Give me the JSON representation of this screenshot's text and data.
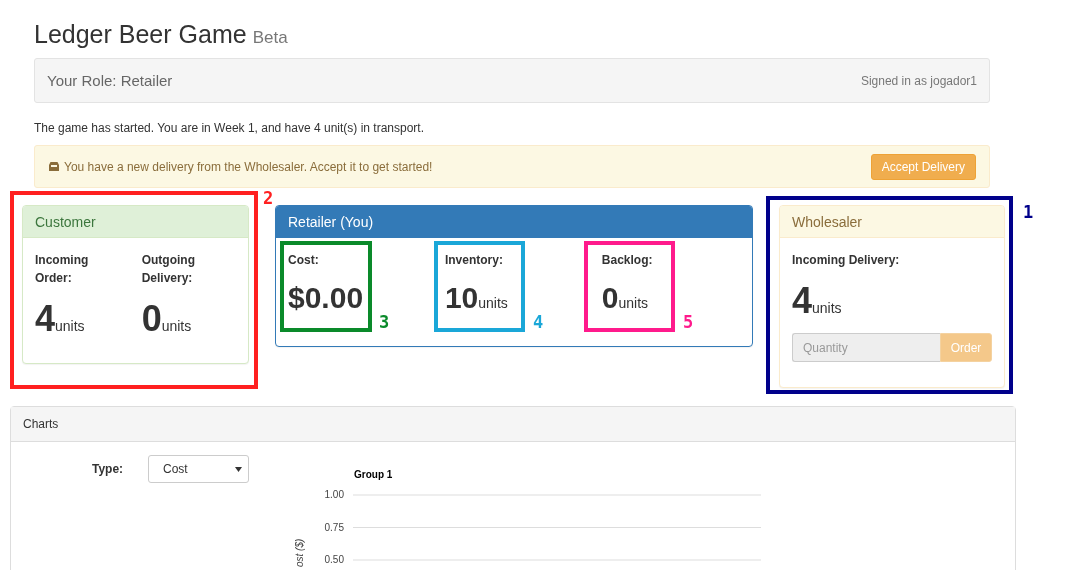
{
  "header": {
    "title": "Ledger Beer Game",
    "badge": "Beta"
  },
  "role_bar": {
    "role": "Your Role: Retailer",
    "signed_in": "Signed in as jogador1"
  },
  "status_text": "The game has started. You are in Week 1, and have 4 unit(s) in transport.",
  "alert": {
    "message": "You have a new delivery from the Wholesaler. Accept it to get started!",
    "button": "Accept Delivery"
  },
  "panels": [
    {
      "kind": "success",
      "title": "Customer",
      "stats": [
        {
          "label": "Incoming Order:",
          "value": "4",
          "unit": "units"
        },
        {
          "label": "Outgoing Delivery:",
          "value": "0",
          "unit": "units"
        }
      ]
    },
    {
      "kind": "primary",
      "title": "Retailer (You)",
      "stats": [
        {
          "label": "Cost:",
          "value": "$0.00"
        },
        {
          "label": "Inventory:",
          "value": "10",
          "unit": "units"
        },
        {
          "label": "Backlog:",
          "value": "0",
          "unit": "units"
        }
      ]
    },
    {
      "kind": "warning",
      "title": "Wholesaler",
      "stats": [
        {
          "label": "Incoming Delivery:",
          "value": "4",
          "unit": "units"
        }
      ],
      "order": {
        "placeholder": "Quantity",
        "button": "Order",
        "disabled": true
      }
    }
  ],
  "charts": {
    "title": "Charts",
    "type_label": "Type:",
    "type_value": "Cost",
    "plot": {
      "title": "Group 1",
      "ylabel": "ost ($)",
      "ticks": [
        "1.00",
        "0.75",
        "0.50"
      ]
    }
  },
  "annotations": [
    {
      "label": "2",
      "color": "#ff2020"
    },
    {
      "label": "3",
      "color": "#0a8a2a"
    },
    {
      "label": "4",
      "color": "#1aa7d8"
    },
    {
      "label": "5",
      "color": "#ff1a8c"
    },
    {
      "label": "1",
      "color": "#00008b"
    }
  ]
}
